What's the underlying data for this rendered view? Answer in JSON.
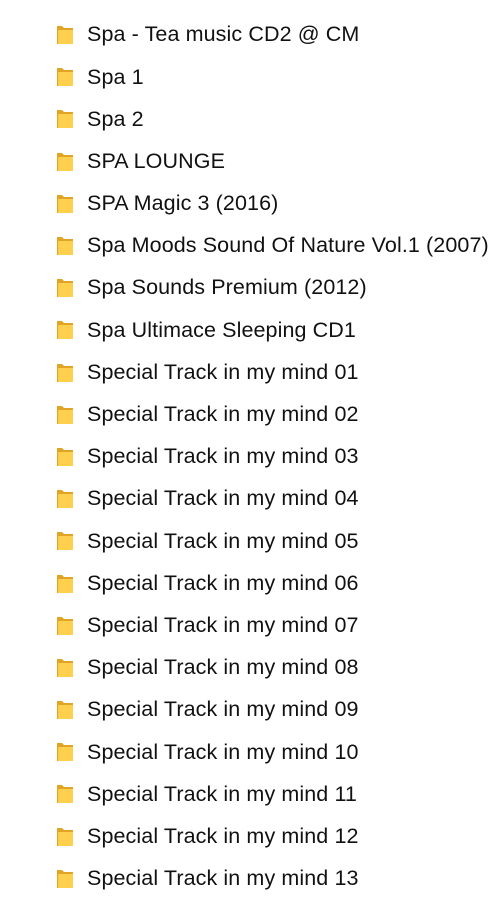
{
  "folders": [
    {
      "name": "Spa - Tea music CD2 @ CM",
      "icon": "folder-icon"
    },
    {
      "name": "Spa 1",
      "icon": "folder-icon"
    },
    {
      "name": "Spa 2",
      "icon": "folder-icon"
    },
    {
      "name": "SPA LOUNGE",
      "icon": "folder-icon"
    },
    {
      "name": "SPA Magic 3 (2016)",
      "icon": "folder-icon"
    },
    {
      "name": "Spa Moods Sound Of Nature Vol.1 (2007)",
      "icon": "folder-icon"
    },
    {
      "name": "Spa Sounds Premium (2012)",
      "icon": "folder-icon"
    },
    {
      "name": "Spa Ultimace Sleeping CD1",
      "icon": "folder-icon"
    },
    {
      "name": "Special Track in my mind 01",
      "icon": "folder-icon"
    },
    {
      "name": "Special Track in my mind 02",
      "icon": "folder-icon"
    },
    {
      "name": "Special Track in my mind 03",
      "icon": "folder-icon"
    },
    {
      "name": "Special Track in my mind 04",
      "icon": "folder-icon"
    },
    {
      "name": "Special Track in my mind 05",
      "icon": "folder-icon"
    },
    {
      "name": "Special Track in my mind 06",
      "icon": "folder-icon"
    },
    {
      "name": "Special Track in my mind 07",
      "icon": "folder-icon"
    },
    {
      "name": "Special Track in my mind 08",
      "icon": "folder-icon"
    },
    {
      "name": "Special Track in my mind 09",
      "icon": "folder-icon"
    },
    {
      "name": "Special Track in my mind 10",
      "icon": "folder-icon"
    },
    {
      "name": "Special Track in my mind 11",
      "icon": "folder-icon"
    },
    {
      "name": "Special Track in my mind 12",
      "icon": "folder-icon"
    },
    {
      "name": "Special Track in my mind 13",
      "icon": "folder-icon"
    }
  ],
  "colors": {
    "folder_back": "#E0A526",
    "folder_front": "#FFD04D",
    "text": "#111111",
    "background": "#FFFFFF"
  }
}
